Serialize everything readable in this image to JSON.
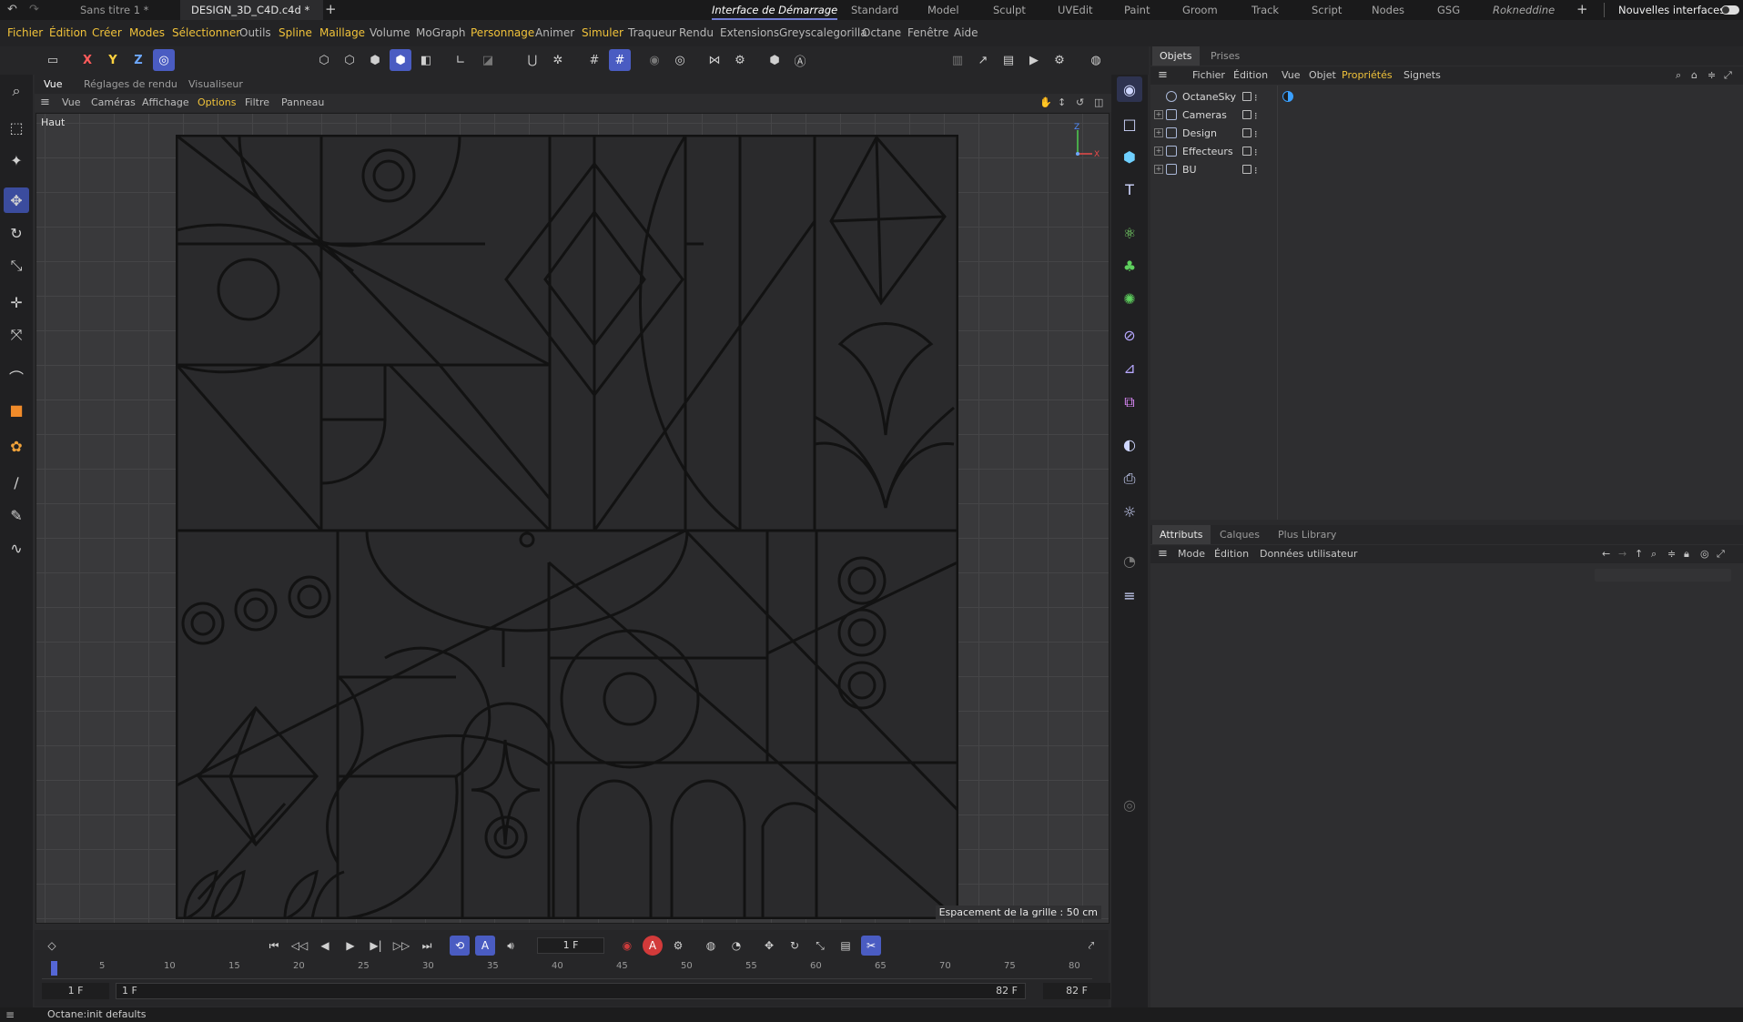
{
  "topbar": {
    "tabs": [
      "Sans titre 1 *",
      "DESIGN_3D_C4D.c4d *"
    ],
    "interfaces": [
      "Interface de Démarrage",
      "Standard",
      "Model",
      "Sculpt",
      "UVEdit",
      "Paint",
      "Groom",
      "Track",
      "Script",
      "Nodes",
      "GSG",
      "Rokneddine"
    ],
    "new_interfaces": "Nouvelles interfaces"
  },
  "menubar": {
    "items": [
      "Fichier",
      "Édition",
      "Créer",
      "Modes",
      "Sélectionner",
      "Outils",
      "Spline",
      "Maillage",
      "Volume",
      "MoGraph",
      "Personnage",
      "Animer",
      "Simuler",
      "Traqueur",
      "Rendu",
      "Extensions",
      "Greyscalegorilla",
      "Octane",
      "Fenêtre",
      "Aide"
    ]
  },
  "toolbar": {
    "axis_x": "X",
    "axis_y": "Y",
    "axis_z": "Z"
  },
  "viewport": {
    "tabs": [
      "Vue",
      "Réglages de rendu",
      "Visualiseur"
    ],
    "menu": [
      "Vue",
      "Caméras",
      "Affichage",
      "Options",
      "Filtre",
      "Panneau"
    ],
    "label": "Haut",
    "grid_spacing": "Espacement de la grille : 50 cm",
    "axis_z": "Z",
    "axis_x": "X"
  },
  "objects_panel": {
    "tabs": [
      "Objets",
      "Prises"
    ],
    "menu": [
      "Fichier",
      "Édition",
      "Vue",
      "Objet",
      "Propriétés",
      "Signets"
    ],
    "objects": [
      "OctaneSky",
      "Cameras",
      "Design",
      "Effecteurs",
      "BU"
    ]
  },
  "attributes_panel": {
    "tabs": [
      "Attributs",
      "Calques",
      "Plus Library"
    ],
    "menu": [
      "Mode",
      "Édition",
      "Données utilisateur"
    ]
  },
  "timeline": {
    "current_frame": "1 F",
    "ruler": [
      "5",
      "10",
      "15",
      "20",
      "25",
      "30",
      "35",
      "40",
      "45",
      "50",
      "55",
      "60",
      "65",
      "70",
      "75",
      "80"
    ],
    "start_frame": "1 F",
    "min_frame": "1 F",
    "end_frame": "82 F",
    "max_frame": "82 F"
  },
  "status": {
    "text": "Octane:init defaults"
  },
  "colors": {
    "accent": "#4a5cc2",
    "menu_highlight": "#f0c23a",
    "panel_bg": "#2e2e30",
    "viewport_bg": "#39393b"
  }
}
